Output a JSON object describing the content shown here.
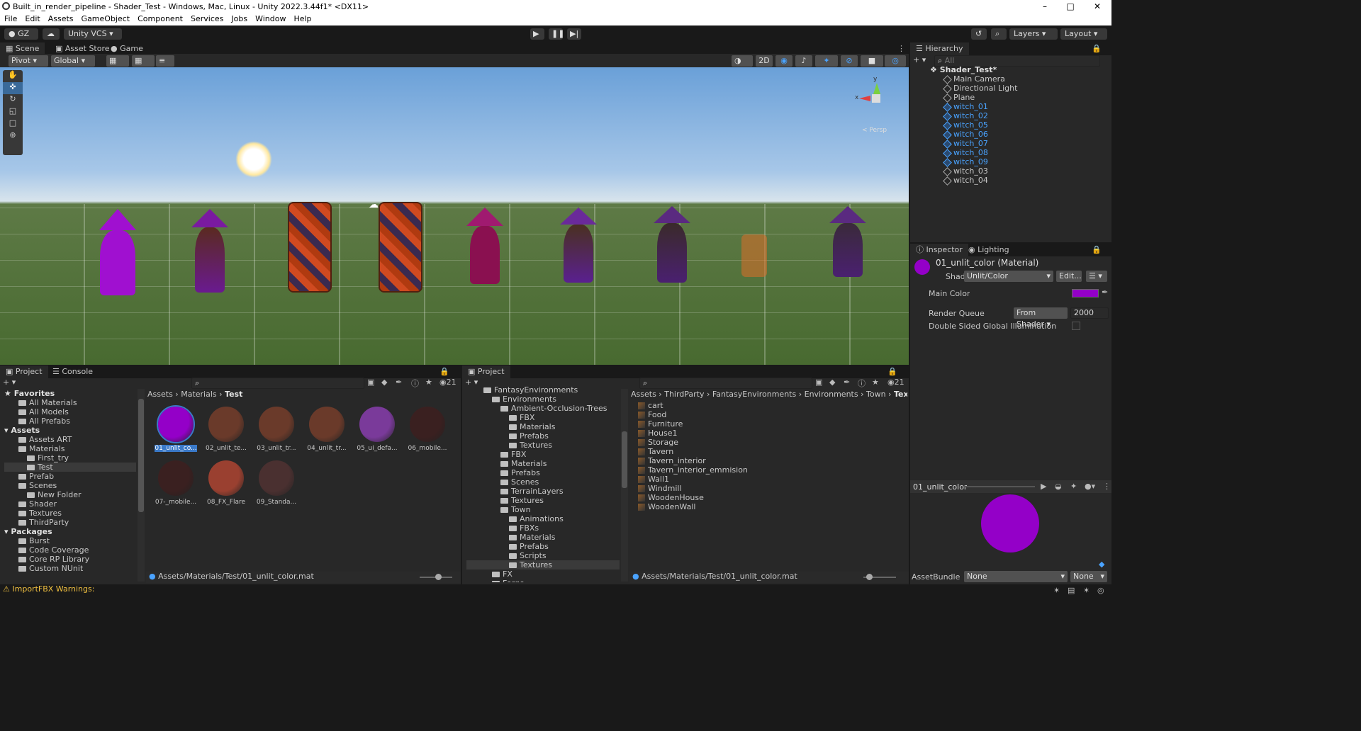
{
  "title_bar": {
    "title": "Built_in_render_pipeline - Shader_Test - Windows, Mac, Linux - Unity 2022.3.44f1* <DX11>"
  },
  "menu": [
    "File",
    "Edit",
    "Assets",
    "GameObject",
    "Component",
    "Services",
    "Jobs",
    "Window",
    "Help"
  ],
  "toolbar": {
    "account": "GZ",
    "vcs": "Unity VCS",
    "layers": "Layers",
    "layout": "Layout"
  },
  "scene_tabs": [
    "Scene",
    "Asset Store",
    "Game"
  ],
  "scene_toolbar": {
    "pivot": "Pivot",
    "global": "Global",
    "mode2d": "2D"
  },
  "gizmo": {
    "x": "x",
    "y": "y",
    "persp": "< Persp"
  },
  "hierarchy": {
    "tab": "Hierarchy",
    "search": "All",
    "root": "Shader_Test*",
    "items": [
      {
        "name": "Main Camera",
        "selected": false
      },
      {
        "name": "Directional Light",
        "selected": false
      },
      {
        "name": "Plane",
        "selected": false
      },
      {
        "name": "witch_01",
        "selected": true
      },
      {
        "name": "witch_02",
        "selected": true
      },
      {
        "name": "witch_05",
        "selected": true
      },
      {
        "name": "witch_06",
        "selected": true
      },
      {
        "name": "witch_07",
        "selected": true
      },
      {
        "name": "witch_08",
        "selected": true
      },
      {
        "name": "witch_09",
        "selected": true
      },
      {
        "name": "witch_03",
        "selected": false
      },
      {
        "name": "witch_04",
        "selected": false
      }
    ]
  },
  "inspector": {
    "tabs": [
      "Inspector",
      "Lighting"
    ],
    "material_name": "01_unlit_color (Material)",
    "shader_label": "Shader",
    "shader_value": "Unlit/Color",
    "edit_label": "Edit...",
    "main_color_label": "Main Color",
    "main_color": "#9400c8",
    "render_queue_label": "Render Queue",
    "render_queue_mode": "From Shader",
    "render_queue_value": "2000",
    "double_sided_label": "Double Sided Global Illumination",
    "preview_name": "01_unlit_color",
    "assetbundle_label": "AssetBundle",
    "assetbundle_value": "None",
    "assetbundle_variant": "None"
  },
  "project_left": {
    "tabs": [
      "Project",
      "Console"
    ],
    "count": "21",
    "tree": [
      {
        "label": "Favorites",
        "level": 0,
        "bold": true
      },
      {
        "label": "All Materials",
        "level": 1
      },
      {
        "label": "All Models",
        "level": 1
      },
      {
        "label": "All Prefabs",
        "level": 1
      },
      {
        "label": "Assets",
        "level": 0,
        "bold": true
      },
      {
        "label": "Assets ART",
        "level": 1
      },
      {
        "label": "Materials",
        "level": 1
      },
      {
        "label": "First_try",
        "level": 2
      },
      {
        "label": "Test",
        "level": 2,
        "selected": true
      },
      {
        "label": "Prefab",
        "level": 1
      },
      {
        "label": "Scenes",
        "level": 1
      },
      {
        "label": "New Folder",
        "level": 2
      },
      {
        "label": "Shader",
        "level": 1
      },
      {
        "label": "Textures",
        "level": 1
      },
      {
        "label": "ThirdParty",
        "level": 1
      },
      {
        "label": "Packages",
        "level": 0,
        "bold": true
      },
      {
        "label": "Burst",
        "level": 1
      },
      {
        "label": "Code Coverage",
        "level": 1
      },
      {
        "label": "Core RP Library",
        "level": 1
      },
      {
        "label": "Custom NUnit",
        "level": 1
      }
    ],
    "breadcrumb": [
      "Assets",
      "Materials",
      "Test"
    ],
    "assets": [
      {
        "label": "01_unlit_co...",
        "color": "#9400c8",
        "selected": true
      },
      {
        "label": "02_unlit_te...",
        "color": "#6a3a2a"
      },
      {
        "label": "03_unlit_tr...",
        "color": "#6a3a2a"
      },
      {
        "label": "04_unlit_tr...",
        "color": "#6a3a2a"
      },
      {
        "label": "05_ui_defa...",
        "color": "#7a3a9a"
      },
      {
        "label": "06_mobile...",
        "color": "#3a2020"
      },
      {
        "label": "07-_mobile...",
        "color": "#3a2020"
      },
      {
        "label": "08_FX_Flare",
        "color": "#9a4030"
      },
      {
        "label": "09_Standa...",
        "color": "#4a3030"
      }
    ],
    "path": "Assets/Materials/Test/01_unlit_color.mat"
  },
  "project_right": {
    "tab": "Project",
    "count": "21",
    "tree": [
      {
        "label": "FantasyEnvironments",
        "level": 0
      },
      {
        "label": "Environments",
        "level": 1
      },
      {
        "label": "Ambient-Occlusion-Trees",
        "level": 2
      },
      {
        "label": "FBX",
        "level": 3
      },
      {
        "label": "Materials",
        "level": 3
      },
      {
        "label": "Prefabs",
        "level": 3
      },
      {
        "label": "Textures",
        "level": 3
      },
      {
        "label": "FBX",
        "level": 2
      },
      {
        "label": "Materials",
        "level": 2
      },
      {
        "label": "Prefabs",
        "level": 2
      },
      {
        "label": "Scenes",
        "level": 2
      },
      {
        "label": "TerrainLayers",
        "level": 2
      },
      {
        "label": "Textures",
        "level": 2
      },
      {
        "label": "Town",
        "level": 2
      },
      {
        "label": "Animations",
        "level": 3
      },
      {
        "label": "FBXs",
        "level": 3
      },
      {
        "label": "Materials",
        "level": 3
      },
      {
        "label": "Prefabs",
        "level": 3
      },
      {
        "label": "Scripts",
        "level": 3
      },
      {
        "label": "Textures",
        "level": 3,
        "selected": true
      },
      {
        "label": "FX",
        "level": 1
      },
      {
        "label": "Forge",
        "level": 1
      }
    ],
    "breadcrumb": [
      "Assets",
      "ThirdParty",
      "FantasyEnvironments",
      "Environments",
      "Town",
      "Textures"
    ],
    "files": [
      "cart",
      "Food",
      "Furniture",
      "House1",
      "Storage",
      "Tavern",
      "Tavern_interior",
      "Tavern_interior_emmision",
      "Wall1",
      "Windmill",
      "WoodenHouse",
      "WoodenWall"
    ],
    "path": "Assets/Materials/Test/01_unlit_color.mat"
  },
  "status": {
    "warning": "ImportFBX Warnings:"
  }
}
